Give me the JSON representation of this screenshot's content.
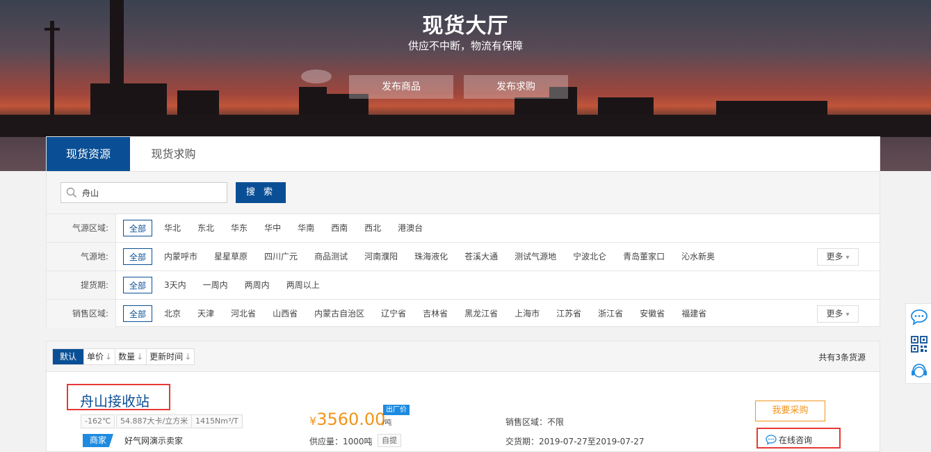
{
  "banner": {
    "title": "现货大厅",
    "subtitle": "供应不中断，物流有保障",
    "publish_goods": "发布商品",
    "publish_purchase": "发布求购"
  },
  "tabs": [
    {
      "label": "现货资源",
      "active": true
    },
    {
      "label": "现货求购",
      "active": false
    }
  ],
  "search": {
    "value": "舟山",
    "button": "搜 索",
    "icon": "search-icon"
  },
  "filters": [
    {
      "label": "气源区域:",
      "options": [
        "全部",
        "华北",
        "东北",
        "华东",
        "华中",
        "华南",
        "西南",
        "西北",
        "港澳台"
      ],
      "selected": "全部",
      "more": ""
    },
    {
      "label": "气源地:",
      "options": [
        "全部",
        "内蒙呼市",
        "星星草原",
        "四川广元",
        "商品测试",
        "河南濮阳",
        "珠海液化",
        "苍溪大通",
        "测试气源地",
        "宁波北仑",
        "青岛董家口",
        "沁水新奥"
      ],
      "selected": "全部",
      "more": "更多"
    },
    {
      "label": "提货期:",
      "options": [
        "全部",
        "3天内",
        "一周内",
        "两周内",
        "两周以上"
      ],
      "selected": "全部",
      "more": ""
    },
    {
      "label": "销售区域:",
      "options": [
        "全部",
        "北京",
        "天津",
        "河北省",
        "山西省",
        "内蒙古自治区",
        "辽宁省",
        "吉林省",
        "黑龙江省",
        "上海市",
        "江苏省",
        "浙江省",
        "安徽省",
        "福建省"
      ],
      "selected": "全部",
      "more": "更多"
    }
  ],
  "sort": {
    "options": [
      {
        "label": "默认",
        "active": true
      },
      {
        "label": "单价",
        "active": false
      },
      {
        "label": "数量",
        "active": false
      },
      {
        "label": "更新时间",
        "active": false
      }
    ],
    "arrow": "↓",
    "total": "共有3条货源"
  },
  "item": {
    "station": "舟山接收站",
    "specs": [
      "-162℃",
      "54.887大卡/立方米",
      "1415Nm³/T"
    ],
    "seller_badge": "商家",
    "seller": "好气网演示卖家",
    "currency": "¥",
    "price": "3560.00",
    "price_unit": "/吨",
    "price_tag": "出厂价",
    "supply": "供应量：1000吨",
    "pickup": "自提",
    "sale_area": "销售区域：不限",
    "delivery": "交货期：2019-07-27至2019-07-27",
    "buy": "我要采购",
    "consult": "在线咨询"
  },
  "colors": {
    "primary": "#0a4f95",
    "accent": "#f29419",
    "highlight": "#e53935",
    "badge": "#1e8be0"
  }
}
